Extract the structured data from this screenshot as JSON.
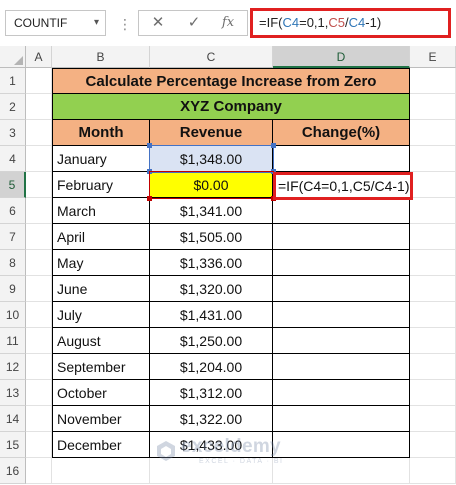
{
  "formula_bar": {
    "name_box": "COUNTIF",
    "name_box_arrow": "▾",
    "separator": "⋮",
    "cancel_icon": "✕",
    "enter_icon": "✓",
    "fx_label": "fx",
    "formula_parts": [
      "=IF(",
      "C4",
      "=0,1,",
      "C5",
      "/",
      "C4",
      "-1)"
    ]
  },
  "columns": [
    "A",
    "B",
    "C",
    "D",
    "E"
  ],
  "rows": [
    "1",
    "2",
    "3",
    "4",
    "5",
    "6",
    "7",
    "8",
    "9",
    "10",
    "11",
    "12",
    "13",
    "14",
    "15",
    "16"
  ],
  "sheet": {
    "title": "Calculate Percentage Increase from Zero",
    "company": "XYZ Company",
    "headers": {
      "month": "Month",
      "revenue": "Revenue",
      "change": "Change(%)"
    },
    "data": [
      {
        "month": "January",
        "revenue": "$1,348.00"
      },
      {
        "month": "February",
        "revenue": "$0.00"
      },
      {
        "month": "March",
        "revenue": "$1,341.00"
      },
      {
        "month": "April",
        "revenue": "$1,505.00"
      },
      {
        "month": "May",
        "revenue": "$1,336.00"
      },
      {
        "month": "June",
        "revenue": "$1,320.00"
      },
      {
        "month": "July",
        "revenue": "$1,431.00"
      },
      {
        "month": "August",
        "revenue": "$1,250.00"
      },
      {
        "month": "September",
        "revenue": "$1,204.00"
      },
      {
        "month": "October",
        "revenue": "$1,312.00"
      },
      {
        "month": "November",
        "revenue": "$1,322.00"
      },
      {
        "month": "December",
        "revenue": "$1,433.00"
      }
    ],
    "active_cell_text": "=IF(C4=0,1,C5/C4-1)"
  },
  "watermark": {
    "name": "exceldemy",
    "tagline": "EXCEL · DATA · BI"
  },
  "colors": {
    "title_fill": "#f4b183",
    "company_fill": "#92d050",
    "highlight_blue": "#dae3f3",
    "highlight_yellow": "#ffff00",
    "callout_red": "#e02020",
    "ref_blue": "#2e75b6",
    "ref_red": "#c0504d"
  }
}
